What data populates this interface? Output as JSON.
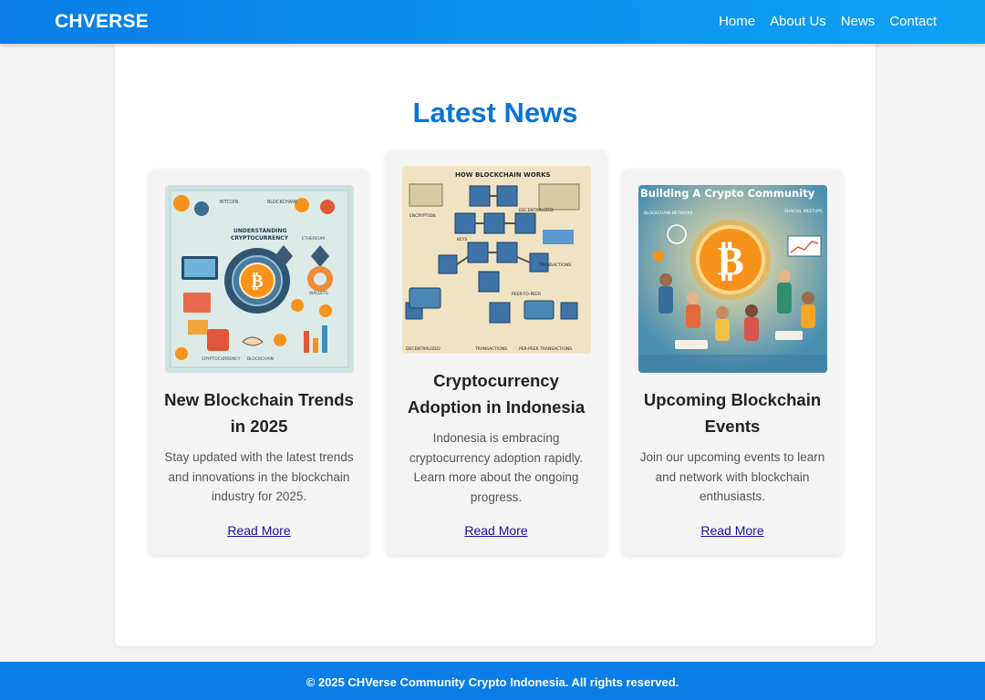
{
  "header": {
    "brand": "CHVERSE",
    "nav": [
      "Home",
      "About Us",
      "News",
      "Contact"
    ]
  },
  "main": {
    "title": "Latest News",
    "cards": [
      {
        "image_text": [
          "BITCOIN",
          "UNDERSTANDING",
          "CRYPTOCURRENCY",
          "ETHEREUM",
          "WALLETS",
          "BLOCKCHAIN"
        ],
        "title": "New Blockchain Trends in 2025",
        "description": "Stay updated with the latest trends and innovations in the blockchain industry for 2025.",
        "link": "Read More"
      },
      {
        "image_text": [
          "HOW BLOCKCHAIN WORKS",
          "ENCRYPTION",
          "KEYS",
          "DECENTRALIZED TRANSACTIONS",
          "PEER-TO-PEER TRANSACTIONS"
        ],
        "title": "Cryptocurrency Adoption in Indonesia",
        "description": "Indonesia is embracing cryptocurrency adoption rapidly. Learn more about the ongoing progress.",
        "link": "Read More"
      },
      {
        "image_text": [
          "Building A Crypto Community",
          "BLOCKCHAIN NETWORK",
          "SHACIAL MEETUPS"
        ],
        "title": "Upcoming Blockchain Events",
        "description": "Join our upcoming events to learn and network with blockchain enthusiasts.",
        "link": "Read More"
      }
    ]
  },
  "footer": {
    "text": "© 2025 CHVerse Community Crypto Indonesia. All rights reserved."
  },
  "colors": {
    "header": "#0a7ee6",
    "title": "#0a74d4",
    "link": "#1a0dab",
    "bitcoin": "#f7931a"
  },
  "icons": [
    "bitcoin-icon",
    "blockchain-cube-icon",
    "ethereum-icon"
  ]
}
